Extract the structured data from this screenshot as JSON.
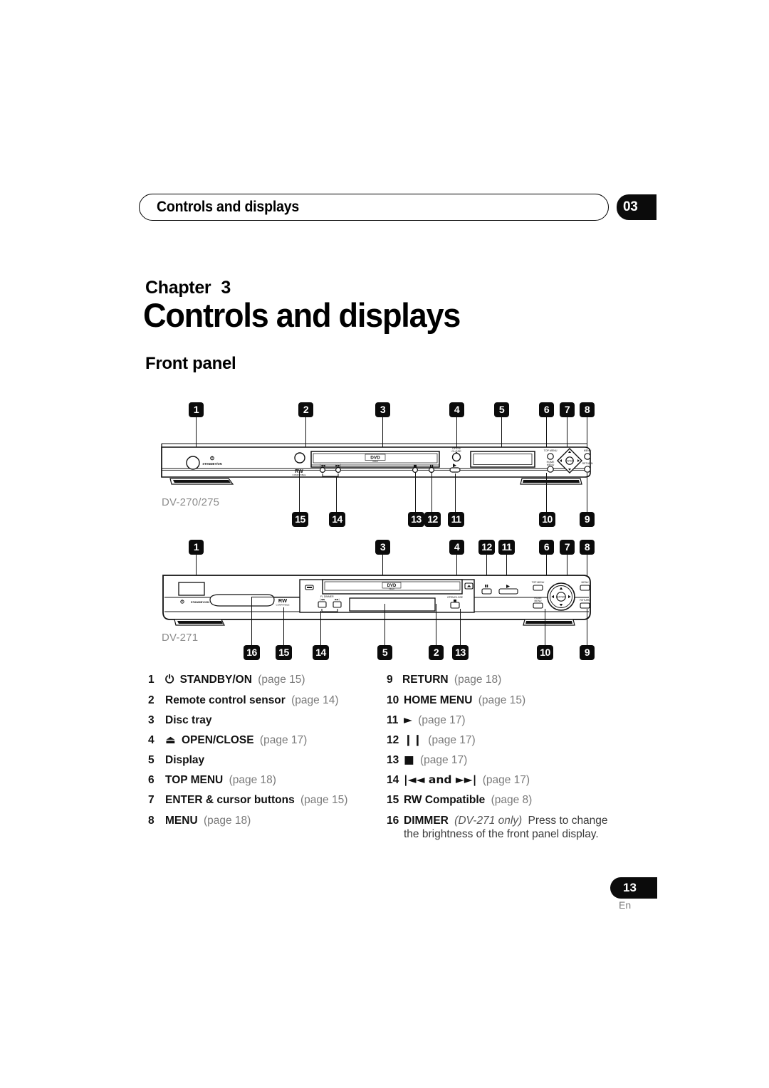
{
  "header": {
    "running_title": "Controls and displays",
    "chapter_tab": "03"
  },
  "chapter": {
    "label": "Chapter",
    "number": "3",
    "title": "Controls and displays",
    "section": "Front panel"
  },
  "diagrams": [
    {
      "model_label": "DV-270/275",
      "top_callouts": [
        "1",
        "2",
        "3",
        "4",
        "5",
        "6",
        "7",
        "8"
      ],
      "bottom_callouts": [
        "15",
        "14",
        "13",
        "12",
        "11",
        "10",
        "9"
      ],
      "panel_texts": {
        "standby": "STANDBY/ON",
        "disc_logo": "DVD",
        "disc_logo_sub": "VIDEO",
        "rw_logo": "RW",
        "rw_logo_sub": "COMPATIBLE",
        "open_close": "OPEN/\nCLOSE",
        "top_menu": "TOP MENU",
        "home_menu": "HOME\nMENU",
        "menu": "MENU",
        "return": "RETURN",
        "enter": "ENTER"
      }
    },
    {
      "model_label": "DV-271",
      "top_callouts": [
        "1",
        "3",
        "4",
        "12",
        "11",
        "6",
        "7",
        "8"
      ],
      "bottom_callouts": [
        "16",
        "15",
        "14",
        "5",
        "2",
        "13",
        "10",
        "9"
      ],
      "panel_texts": {
        "standby": "STANDBY/ON",
        "disc_logo": "DVD",
        "disc_logo_sub": "VIDEO",
        "rw_logo": "RW",
        "rw_logo_sub": "COMPATIBLE",
        "dimmer": "FL DIMMER",
        "open_close": "OPEN/CLOSE",
        "top_menu": "TOP MENU",
        "home_menu": "HOME\nMENU",
        "menu": "MENU",
        "return": "RETURN",
        "enter": "ENTER"
      }
    }
  ],
  "legend": {
    "left": [
      {
        "num": "1",
        "icon": "⏻",
        "label": "STANDBY/ON",
        "page": "(page 15)"
      },
      {
        "num": "2",
        "icon": "",
        "label": "Remote control sensor",
        "page": "(page 14)"
      },
      {
        "num": "3",
        "icon": "",
        "label": "Disc tray",
        "page": ""
      },
      {
        "num": "4",
        "icon": "⏏",
        "label": "OPEN/CLOSE",
        "page": "(page 17)"
      },
      {
        "num": "5",
        "icon": "",
        "label": "Display",
        "page": ""
      },
      {
        "num": "6",
        "icon": "",
        "label": "TOP MENU",
        "page": "(page 18)"
      },
      {
        "num": "7",
        "icon": "",
        "label": "ENTER & cursor buttons",
        "page": "(page 15)"
      },
      {
        "num": "8",
        "icon": "",
        "label": "MENU",
        "page": "(page 18)"
      }
    ],
    "right": [
      {
        "num": "9",
        "icon": "",
        "label": "RETURN",
        "page": "(page 18)"
      },
      {
        "num": "10",
        "icon": "",
        "label": "HOME MENU",
        "page": "(page 15)"
      },
      {
        "num": "11",
        "icon": "►",
        "label": "",
        "page": "(page 17)"
      },
      {
        "num": "12",
        "icon": "❙❙",
        "label": "",
        "page": "(page 17)"
      },
      {
        "num": "13",
        "icon": "■",
        "label": "",
        "page": "(page 17)"
      },
      {
        "num": "14",
        "icon": "|◄◄ and ►►|",
        "label": "and",
        "page": "(page 17)"
      },
      {
        "num": "15",
        "icon": "",
        "label": "RW Compatible",
        "page": "(page 8)"
      },
      {
        "num": "16",
        "icon": "",
        "label": "DIMMER",
        "note": "(DV-271 only)",
        "page": "",
        "body": "Press to change the brightness of the front panel display."
      }
    ]
  },
  "footer": {
    "page_number": "13",
    "language": "En"
  }
}
